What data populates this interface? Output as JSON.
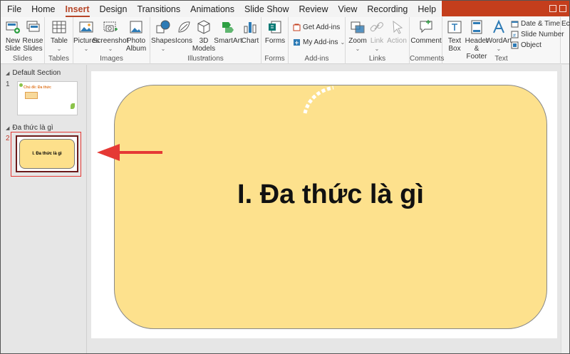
{
  "tabs": [
    "File",
    "Home",
    "Insert",
    "Design",
    "Transitions",
    "Animations",
    "Slide Show",
    "Review",
    "View",
    "Recording",
    "Help"
  ],
  "active_tab": "Insert",
  "ribbon": {
    "slides": {
      "label": "Slides",
      "new_slide": "New\nSlide",
      "reuse_slides": "Reuse\nSlides"
    },
    "tables": {
      "label": "Tables",
      "table": "Table"
    },
    "images": {
      "label": "Images",
      "pictures": "Pictures",
      "screenshot": "Screenshot",
      "photo_album": "Photo\nAlbum"
    },
    "illustrations": {
      "label": "Illustrations",
      "shapes": "Shapes",
      "icons": "Icons",
      "models_3d": "3D\nModels",
      "smartart": "SmartArt",
      "chart": "Chart"
    },
    "forms": {
      "label": "Forms",
      "forms": "Forms"
    },
    "addins": {
      "label": "Add-ins",
      "get_addins": "Get Add-ins",
      "my_addins": "My Add-ins"
    },
    "links": {
      "label": "Links",
      "zoom": "Zoom",
      "link": "Link",
      "action": "Action"
    },
    "comments": {
      "label": "Comments",
      "comment": "Comment"
    },
    "text": {
      "label": "Text",
      "text_box": "Text\nBox",
      "header_footer": "Header\n& Footer",
      "wordart": "WordArt",
      "date_time": "Date & Time",
      "slide_number": "Slide Number",
      "object": "Object"
    },
    "partial": "Ec"
  },
  "thumbnails": {
    "section1": "Default Section",
    "slide1_num": "1",
    "slide1_title": "Chủ đề: Đa thức",
    "section2": "Đa thức là gì",
    "slide2_num": "2",
    "slide2_title": "I. Đa thức là gì"
  },
  "slide": {
    "title": "I. Đa thức là gì",
    "card_color": "#fde18d"
  },
  "colors": {
    "accent": "#b7472a",
    "arrow": "#e53935"
  }
}
